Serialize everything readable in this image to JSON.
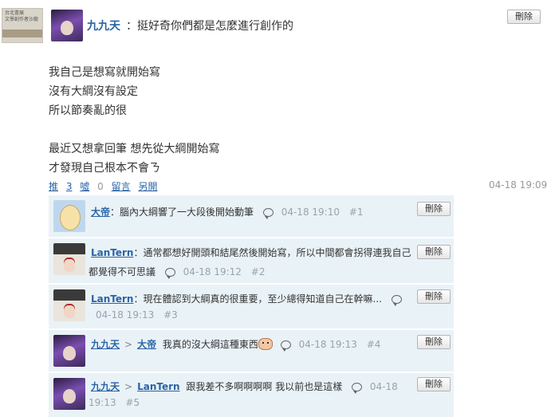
{
  "post": {
    "image_caption": "台北書展\n文學創作者沙龍",
    "author": "九九天",
    "separator": "：",
    "title": "挺好奇你們都是怎麼進行創作的",
    "delete_label": "刪除",
    "body": [
      "我自己是想寫就開始寫",
      "沒有大綱沒有設定",
      "所以節奏亂的很",
      "",
      "最近又想拿回筆 想先從大綱開始寫",
      "才發現自己根本不會ㄋ"
    ],
    "actions": {
      "push_label": "推",
      "push_count": "3",
      "boo_label": "噓",
      "boo_count": "0",
      "comment_label": "留言",
      "other_label": "另開"
    },
    "time": "04-18 19:09"
  },
  "comments": [
    {
      "author": "大帝",
      "text": "腦內大綱響了一大段後開始動筆",
      "time": "04-18 19:10",
      "floor": "#1",
      "delete_label": "刪除"
    },
    {
      "author": "LanTern",
      "text_line1": "通常都想好開頭和結尾然後開始寫，所以中間都會拐得連我自己",
      "text_line2": "都覺得不可思議",
      "time": "04-18 19:12",
      "floor": "#2",
      "delete_label": "刪除"
    },
    {
      "author": "LanTern",
      "text": "現在體認到大綱真的很重要，至少總得知道自己在幹嘛...",
      "time": "04-18 19:13",
      "floor": "#3",
      "delete_label": "刪除"
    },
    {
      "author": "九九天",
      "reply_to": "大帝",
      "arrow": ">",
      "text": "我真的沒大綱這種東西",
      "time": "04-18 19:13",
      "floor": "#4",
      "delete_label": "刪除"
    },
    {
      "author": "九九天",
      "reply_to": "LanTern",
      "arrow": ">",
      "text": "跟我差不多啊啊啊啊 我以前也是這樣",
      "time_part1": "04-18",
      "time_part2": "19:13",
      "floor": "#5",
      "delete_label": "刪除"
    }
  ],
  "colors": {
    "link": "#2a64a5",
    "comment_bg": "#e9f2f7",
    "meta": "#9aa3ab"
  }
}
